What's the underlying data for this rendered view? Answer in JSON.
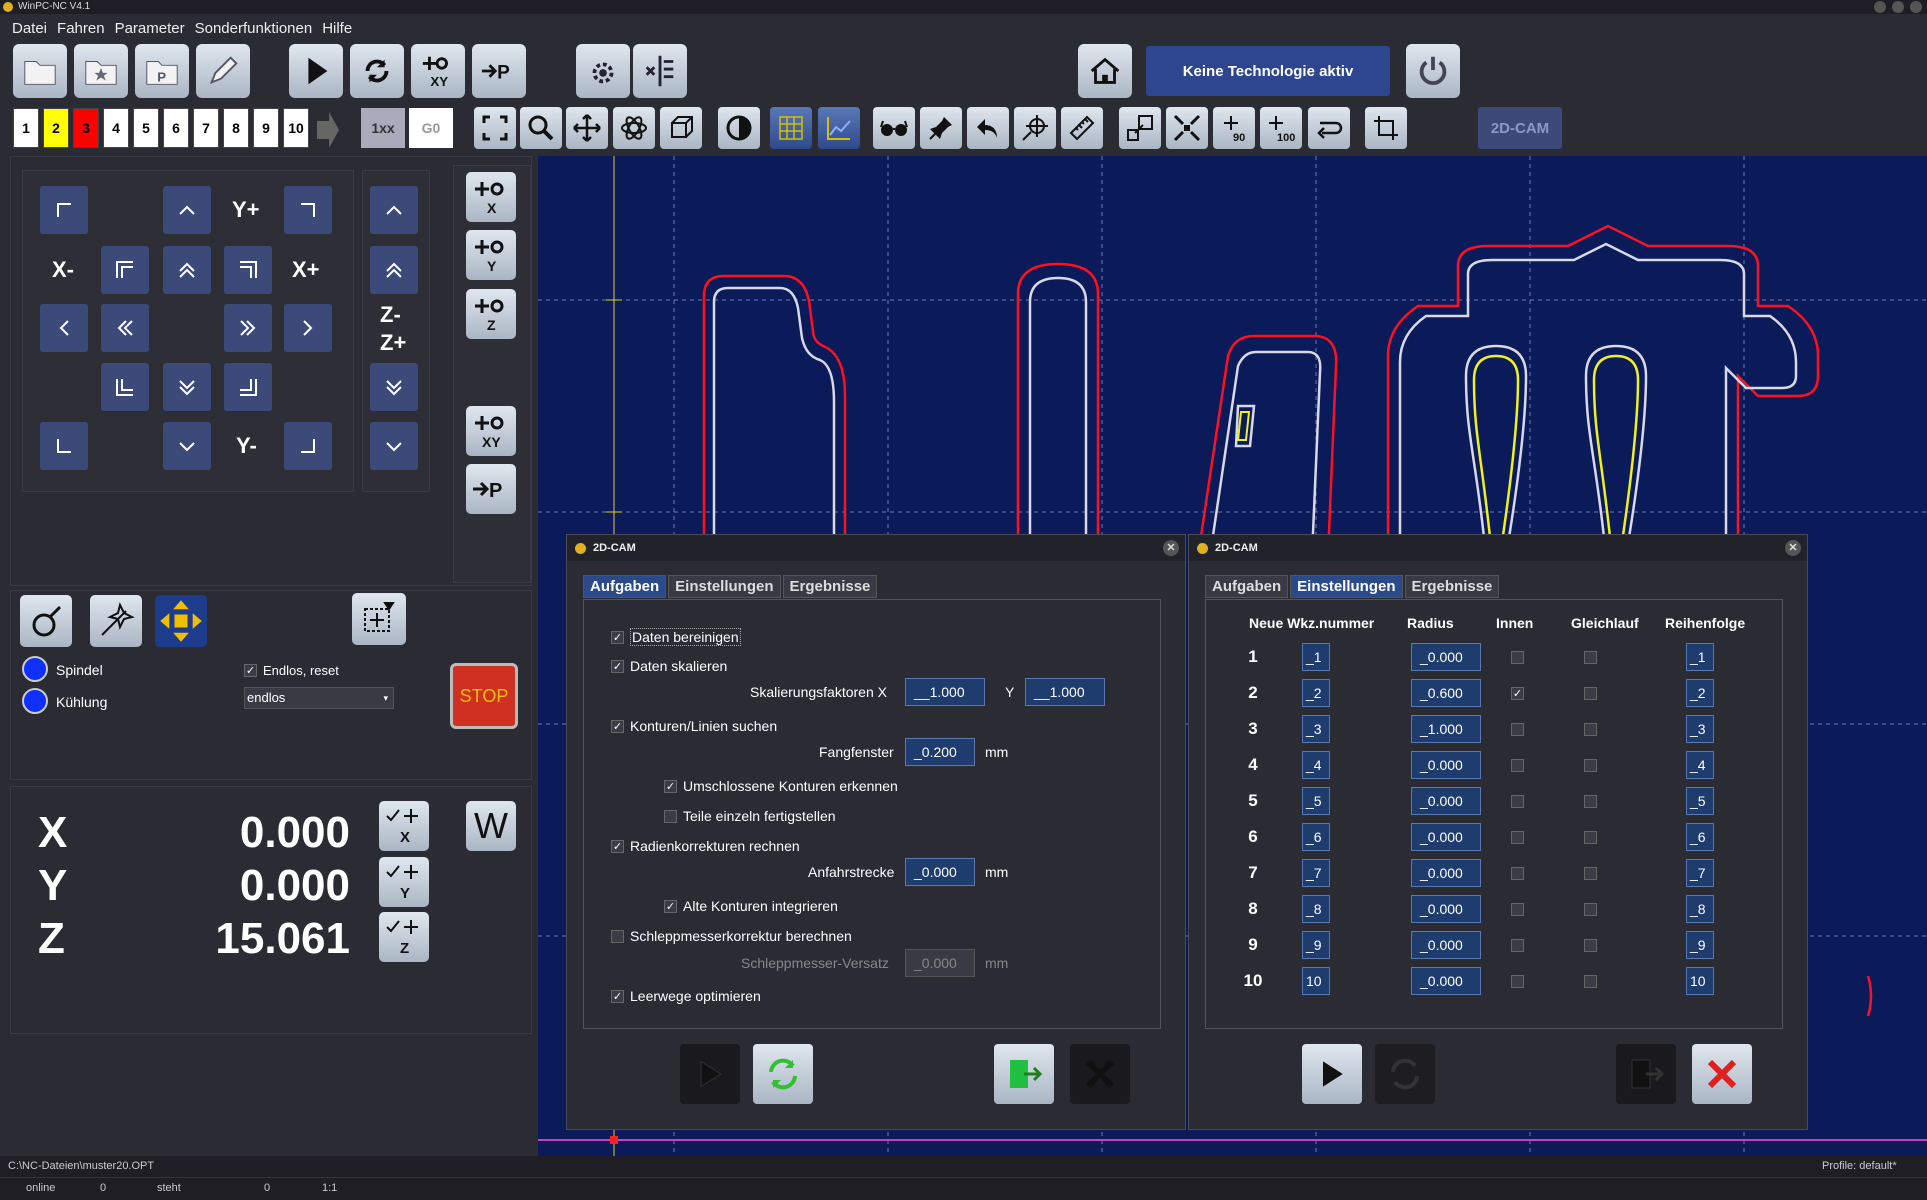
{
  "app": {
    "title": "WinPC-NC V4.1"
  },
  "menu": [
    "Datei",
    "Fahren",
    "Parameter",
    "Sonderfunktionen",
    "Hilfe"
  ],
  "toolbar": {
    "technology": "Keine Technologie aktiv",
    "cam_label": "2D-CAM",
    "btn_1xx": "1xx",
    "btn_g0": "G0"
  },
  "tool_numbers": [
    "1",
    "2",
    "3",
    "4",
    "5",
    "6",
    "7",
    "8",
    "9",
    "10"
  ],
  "tool_colors": [
    "#ffffff",
    "#ffff00",
    "#ff0000",
    "#ffffff",
    "#ffffff",
    "#ffffff",
    "#ffffff",
    "#ffffff",
    "#ffffff",
    "#ffffff"
  ],
  "jog": {
    "yplus": "Y+",
    "yminus": "Y-",
    "xminus": "X-",
    "xplus": "X+",
    "zminus": "Z-",
    "zplus": "Z+"
  },
  "side": {
    "spindel": "Spindel",
    "kuehlung": "Kühlung",
    "endlos_reset": "Endlos, reset",
    "endlos_value": "endlos",
    "stop": "STOP",
    "w_label": "W"
  },
  "coords": [
    {
      "axis": "X",
      "value": "0.000"
    },
    {
      "axis": "Y",
      "value": "0.000"
    },
    {
      "axis": "Z",
      "value": "15.061"
    }
  ],
  "dialog1": {
    "title": "2D-CAM",
    "tabs": [
      "Aufgaben",
      "Einstellungen",
      "Ergebnisse"
    ],
    "daten_bereinigen": "Daten bereinigen",
    "daten_skalieren": "Daten skalieren",
    "skalierungsfaktoren": "Skalierungsfaktoren  X",
    "y_label": "Y",
    "scale_x": "__1.000",
    "scale_y": "__1.000",
    "konturen": "Konturen/Linien suchen",
    "fangfenster": "Fangfenster",
    "fang_value": "_0.200",
    "mm": "mm",
    "umschlossene": "Umschlossene Konturen erkennen",
    "teile": "Teile einzeln fertigstellen",
    "radien": "Radienkorrekturen rechnen",
    "anfahrstrecke": "Anfahrstrecke",
    "anfahr_value": "_0.000",
    "alte": "Alte Konturen integrieren",
    "schlepp": "Schleppmesserkorrektur berechnen",
    "schlepp_versatz": "Schleppmesser-Versatz",
    "schlepp_value": "_0.000",
    "leerwege": "Leerwege optimieren"
  },
  "dialog2": {
    "title": "2D-CAM",
    "tabs": [
      "Aufgaben",
      "Einstellungen",
      "Ergebnisse"
    ],
    "headers": [
      "Neue Wkz.nummer",
      "Radius",
      "Innen",
      "Gleichlauf",
      "Reihenfolge"
    ],
    "rows": [
      {
        "n": "1",
        "wkz": "_1",
        "radius": "_0.000",
        "innen": false,
        "order": "_1"
      },
      {
        "n": "2",
        "wkz": "_2",
        "radius": "_0.600",
        "innen": true,
        "order": "_2"
      },
      {
        "n": "3",
        "wkz": "_3",
        "radius": "_1.000",
        "innen": false,
        "order": "_3"
      },
      {
        "n": "4",
        "wkz": "_4",
        "radius": "_0.000",
        "innen": false,
        "order": "_4"
      },
      {
        "n": "5",
        "wkz": "_5",
        "radius": "_0.000",
        "innen": false,
        "order": "_5"
      },
      {
        "n": "6",
        "wkz": "_6",
        "radius": "_0.000",
        "innen": false,
        "order": "_6"
      },
      {
        "n": "7",
        "wkz": "_7",
        "radius": "_0.000",
        "innen": false,
        "order": "_7"
      },
      {
        "n": "8",
        "wkz": "_8",
        "radius": "_0.000",
        "innen": false,
        "order": "_8"
      },
      {
        "n": "9",
        "wkz": "_9",
        "radius": "_0.000",
        "innen": false,
        "order": "_9"
      },
      {
        "n": "10",
        "wkz": "10",
        "radius": "_0.000",
        "innen": false,
        "order": "10"
      }
    ]
  },
  "status": {
    "path": "C:\\NC-Dateien\\muster20.OPT",
    "profile": "Profile: default*",
    "online": "online",
    "v1": "0",
    "state": "steht",
    "v2": "0",
    "scale": "1:1"
  }
}
